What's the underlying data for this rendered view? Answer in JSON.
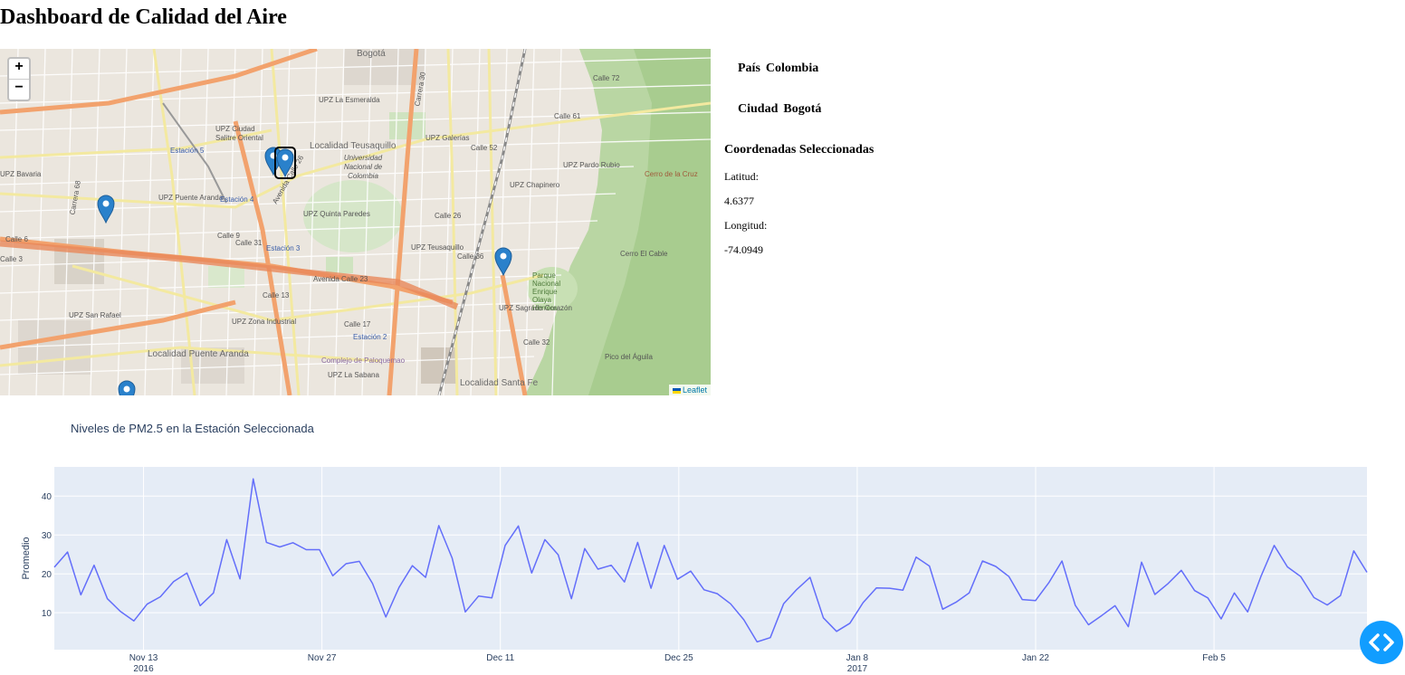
{
  "page": {
    "title": "Dashboard de Calidad del Aire"
  },
  "map": {
    "zoom_in": "+",
    "zoom_out": "−",
    "attribution": "Leaflet",
    "labels": [
      "Bogotá",
      "UPZ La Esmeralda",
      "UPZ Galerías",
      "UPZ Ciudad Salitre Oriental",
      "Localidad Teusaquillo",
      "Universidad Nacional de Colombia",
      "UPZ Pardo Rubio",
      "UPZ Chapinero",
      "UPZ Bavaria",
      "UPZ Puente Aranda",
      "UPZ Quinta Paredes",
      "UPZ Teusaquillo",
      "UPZ Sagrado Corazón",
      "UPZ San Rafael",
      "UPZ Zona Industrial",
      "Localidad Puente Aranda",
      "UPZ La Sabana",
      "Localidad Santa Fe",
      "Cerro El Cable",
      "Pico del Águila",
      "Parque Nacional Enrique Olaya Herrera",
      "Complejo de Paloquemao",
      "Cerro de la Cruz",
      "Avenida Calle 26",
      "Avenida Calle 23",
      "Calle 6",
      "Calle 3",
      "Carrera 68",
      "Calle 26",
      "Calle 36",
      "Calle 61",
      "Calle 52",
      "Calle 72",
      "Carrera 30",
      "Calle 9",
      "Calle 13",
      "Calle 17",
      "Calle 31",
      "Calle 32"
    ],
    "stations": [
      "Estación 5",
      "Estación 4",
      "Estación 3",
      "Estación 2"
    ],
    "marker_count": 6,
    "selected_marker": "Estación seleccionada"
  },
  "info": {
    "pais_label": "País",
    "pais_value": "Colombia",
    "ciudad_label": "Ciudad",
    "ciudad_value": "Bogotá",
    "coords_title": "Coordenadas Seleccionadas",
    "lat_label": "Latitud:",
    "lat_value": "4.6377",
    "lon_label": "Longitud:",
    "lon_value": "-74.0949"
  },
  "chart_title": "Niveles de PM2.5 en la Estación Seleccionada",
  "chart_data": {
    "type": "line",
    "title": "Niveles de PM2.5 en la Estación Seleccionada",
    "xlabel": "",
    "ylabel": "Promedio",
    "x_start": "2016-11-06",
    "x_end": "2017-02-17",
    "ylim": [
      0.5,
      47.5
    ],
    "yticks": [
      10,
      20,
      30,
      40
    ],
    "xticks": [
      {
        "date": "2016-11-13",
        "label": "Nov 13",
        "sub": "2016"
      },
      {
        "date": "2016-11-27",
        "label": "Nov 27",
        "sub": ""
      },
      {
        "date": "2016-12-11",
        "label": "Dec 11",
        "sub": ""
      },
      {
        "date": "2016-12-25",
        "label": "Dec 25",
        "sub": ""
      },
      {
        "date": "2017-01-08",
        "label": "Jan 8",
        "sub": "2017"
      },
      {
        "date": "2017-01-22",
        "label": "Jan 22",
        "sub": ""
      },
      {
        "date": "2017-02-05",
        "label": "Feb 5",
        "sub": ""
      }
    ],
    "grid": true,
    "series": [
      {
        "name": "",
        "color": "#636efa",
        "values": [
          21.7,
          25.6,
          14.6,
          22.2,
          13.6,
          10.3,
          7.9,
          12.2,
          14.1,
          18.0,
          20.2,
          11.8,
          15.1,
          28.8,
          18.7,
          44.4,
          28.1,
          26.9,
          28.0,
          26.2,
          26.2,
          19.5,
          22.6,
          23.2,
          17.5,
          8.9,
          16.5,
          22.1,
          19.1,
          32.4,
          24.1,
          10.2,
          14.3,
          13.8,
          27.3,
          32.3,
          20.2,
          28.8,
          24.9,
          13.6,
          26.5,
          21.2,
          22.2,
          17.9,
          28.1,
          16.3,
          27.3,
          18.6,
          20.7,
          15.9,
          14.9,
          12.3,
          8.2,
          2.5,
          3.6,
          12.3,
          16.0,
          19.1,
          8.7,
          5.2,
          7.3,
          12.6,
          16.4,
          16.3,
          15.8,
          24.3,
          22.0,
          10.9,
          12.7,
          15.1,
          23.3,
          21.9,
          19.3,
          13.4,
          13.1,
          17.7,
          23.3,
          11.9,
          6.9,
          9.3,
          11.8,
          6.4,
          23.0,
          14.7,
          17.5,
          20.9,
          15.7,
          13.8,
          8.4,
          15.1,
          10.2,
          19.3,
          27.3,
          21.8,
          19.3,
          13.9,
          12.0,
          14.4,
          25.9,
          20.4
        ]
      }
    ]
  },
  "nav_fab": {
    "icon": "code-chevrons-icon"
  }
}
